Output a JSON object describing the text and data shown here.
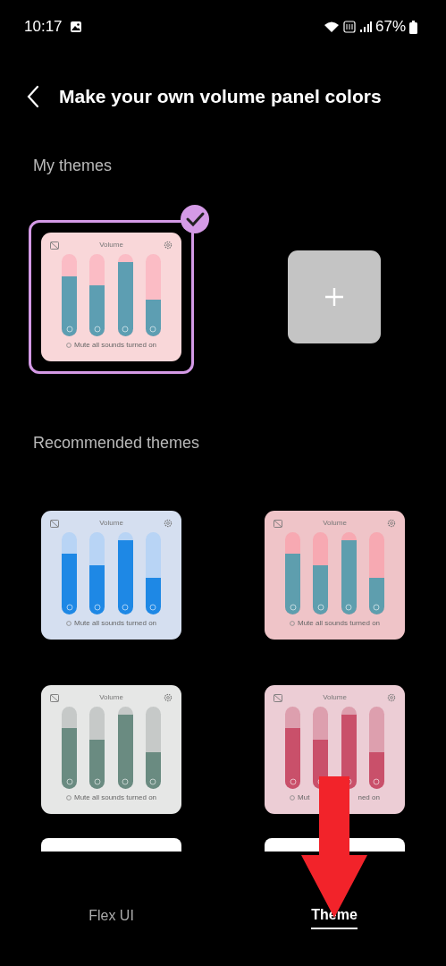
{
  "status_bar": {
    "time": "10:17",
    "battery": "67%"
  },
  "header": {
    "title": "Make your own volume panel colors"
  },
  "my_themes": {
    "heading": "My themes",
    "themes": [
      {
        "title": "Volume",
        "footer": [
          "Mute all sounds turned on"
        ],
        "selected": true,
        "color": "#f9d7d9",
        "track": {
          "color": "#fbbcc5"
        },
        "sliders": [
          {
            "level": 0.73,
            "color": "#5d9eb2"
          },
          {
            "level": 0.62,
            "color": "#5d9eb2"
          },
          {
            "level": 0.9,
            "color": "#5d9eb2"
          },
          {
            "level": 0.45,
            "color": "#5d9eb2"
          }
        ]
      }
    ]
  },
  "recommended": {
    "heading": "Recommended themes",
    "themes": [
      {
        "title": "Volume",
        "footer": [
          "Mute all sounds turned on"
        ],
        "color": "#d5dff0",
        "track": {
          "color": "#b8d4f5"
        },
        "sliders": [
          {
            "level": 0.74,
            "color": "#1e88e5"
          },
          {
            "level": 0.6,
            "color": "#1e88e5"
          },
          {
            "level": 0.9,
            "color": "#1e88e5"
          },
          {
            "level": 0.45,
            "color": "#1e88e5"
          }
        ]
      },
      {
        "title": "Volume",
        "footer": [
          "Mute all sounds turned on"
        ],
        "color": "#efc4c8",
        "track": {
          "color": "#f7a9b2"
        },
        "sliders": [
          {
            "level": 0.74,
            "color": "#5e9eae"
          },
          {
            "level": 0.6,
            "color": "#5e9eae"
          },
          {
            "level": 0.9,
            "color": "#5e9eae"
          },
          {
            "level": 0.45,
            "color": "#5e9eae"
          }
        ]
      },
      {
        "title": "Volume",
        "footer": [
          "Mute all sounds turned on"
        ],
        "color": "#e6e7e6",
        "track": {
          "color": "#c6c9c8"
        },
        "sliders": [
          {
            "level": 0.74,
            "color": "#6a8b81"
          },
          {
            "level": 0.6,
            "color": "#6a8b81"
          },
          {
            "level": 0.9,
            "color": "#6a8b81"
          },
          {
            "level": 0.45,
            "color": "#6a8b81"
          }
        ]
      },
      {
        "title": "Volume",
        "footer": [
          "Mut",
          "ned on"
        ],
        "color": "#eccdd5",
        "track": {
          "color": "#dd9fae"
        },
        "sliders": [
          {
            "level": 0.74,
            "color": "#c9506a"
          },
          {
            "level": 0.6,
            "color": "#c9506a"
          },
          {
            "level": 0.9,
            "color": "#c9506a"
          },
          {
            "level": 0.45,
            "color": "#c9506a"
          }
        ]
      }
    ]
  },
  "bottom_nav": [
    {
      "label": "Flex UI",
      "selected": false
    },
    {
      "label": "Theme",
      "selected": true
    }
  ]
}
